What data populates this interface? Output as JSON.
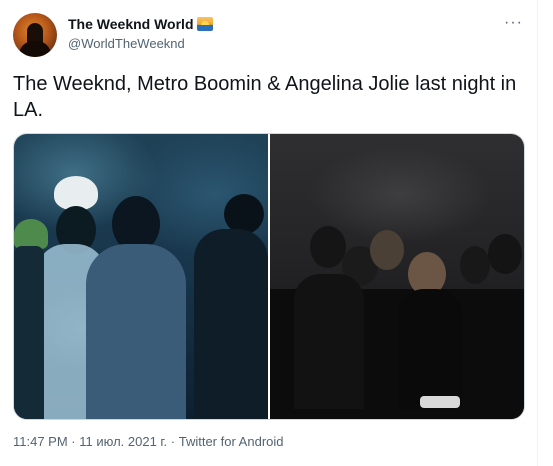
{
  "tweet": {
    "display_name": "The Weeknd World",
    "handle": "@WorldTheWeeknd",
    "badge_icon": "sunrise-emoji-icon",
    "more_icon": "more-dots-icon",
    "more_label": "···",
    "text": "The Weeknd, Metro Boomin & Angelina Jolie last night in LA.",
    "timestamp": "11:47 PM · 11 июл. 2021 г. · Twitter for Android"
  },
  "colors": {
    "text_primary": "#0f1419",
    "text_secondary": "#536471",
    "border": "#cfd9de"
  }
}
